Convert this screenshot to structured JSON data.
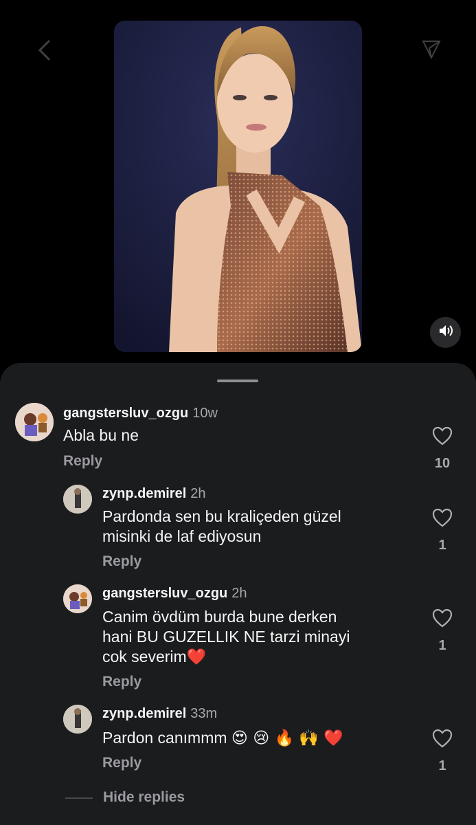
{
  "post": {
    "video_label": "",
    "mute_icon": "speaker-icon"
  },
  "comments": [
    {
      "username": "gangstersluv_ozgu",
      "time": "10w",
      "text": "Abla bu ne",
      "reply_label": "Reply",
      "likes": "10"
    },
    {
      "username": "zynp.demirel",
      "time": "2h",
      "text_line1": "Pardonda sen bu kraliçeden güzel",
      "text_line2": "misinki de laf ediyosun",
      "reply_label": "Reply",
      "likes": "1"
    },
    {
      "username": "gangstersluv_ozgu",
      "time": "2h",
      "text_line1": "Canim övdüm burda bune derken",
      "text_line2": "hani BU GUZELLIK NE tarzi minayi",
      "text_line3": "cok severim",
      "emoji": "❤️",
      "reply_label": "Reply",
      "likes": "1"
    },
    {
      "username": "zynp.demirel",
      "time": "33m",
      "text": "Pardon canımmm",
      "emojis": "😍 😢 🔥 🙌 ❤️",
      "reply_label": "Reply",
      "likes": "1"
    }
  ],
  "hide_replies_label": "Hide replies",
  "colors": {
    "background": "#000000",
    "sheet": "#1b1c1e",
    "secondary_text": "#a8a8ad",
    "heart": "#e0245e"
  }
}
